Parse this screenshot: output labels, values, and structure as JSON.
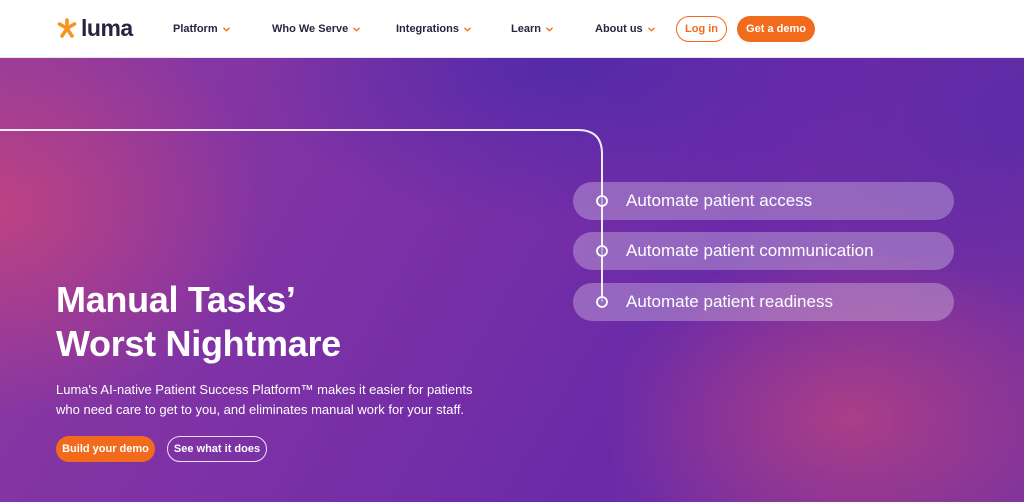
{
  "nav": {
    "logo_text": "luma",
    "items": [
      {
        "label": "Platform"
      },
      {
        "label": "Who We Serve"
      },
      {
        "label": "Integrations"
      },
      {
        "label": "Learn"
      },
      {
        "label": "About us"
      }
    ],
    "login_label": "Log in",
    "demo_label": "Get a demo"
  },
  "hero": {
    "features": [
      {
        "label": "Automate patient access"
      },
      {
        "label": "Automate patient communication"
      },
      {
        "label": "Automate patient readiness"
      }
    ],
    "headline": [
      "Manual Tasks’",
      "Worst Nightmare"
    ],
    "subtext": [
      "Luma's AI-native Patient Success Platform™ makes it easier for patients",
      "who need care to get to you, and eliminates manual work for your staff."
    ],
    "primary_cta": "Build your demo",
    "secondary_cta": "See what it does"
  },
  "colors": {
    "accent": "#f26a1b",
    "nav_text": "#2a2340",
    "hero_purple": "#6a2aa8",
    "hero_pink": "#c84678"
  },
  "icons": {
    "logo": "orange-star-asterisk-icon",
    "nav_dropdown": "chevron-down-icon",
    "timeline_node": "circle-node-icon"
  }
}
